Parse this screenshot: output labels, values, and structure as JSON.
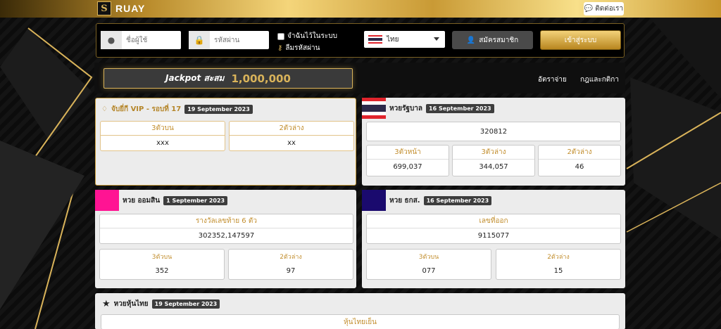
{
  "header": {
    "brand_letter": "S",
    "brand_name": "RUAY",
    "contact_label": "ติดต่อเรา"
  },
  "login": {
    "username_placeholder": "ชื่อผู้ใช้",
    "password_placeholder": "รหัสผ่าน",
    "remember_label": "จำฉันไว้ในระบบ",
    "forgot_label": "ลืมรหัสผ่าน",
    "language": "ไทย",
    "register_label": "สมัครสมาชิก",
    "login_label": "เข้าสู่ระบบ"
  },
  "jackpot": {
    "label": "Jackpot สะสม",
    "value": "1,000,000"
  },
  "nav": {
    "rates": "อัตราจ่าย",
    "rules": "กฎและกติกา"
  },
  "vip": {
    "title": "จับยี่กี VIP - รอบที่ 17",
    "date": "19 September 2023",
    "cols": [
      {
        "label": "3ตัวบน",
        "value": "xxx"
      },
      {
        "label": "2ตัวล่าง",
        "value": "xx"
      }
    ]
  },
  "gov": {
    "title": "หวยรัฐบาล",
    "date": "16 September 2023",
    "first_prize": "320812",
    "cols": [
      {
        "label": "3ตัวหน้า",
        "value": "699,037"
      },
      {
        "label": "3ตัวล่าง",
        "value": "344,057"
      },
      {
        "label": "2ตัวล่าง",
        "value": "46"
      }
    ]
  },
  "gsb": {
    "title": "หวย ออมสิน",
    "date": "1 September 2023",
    "prize_label": "รางวัลเลขท้าย 6 ตัว",
    "prize_value": "302352,147597",
    "cols": [
      {
        "label": "3ตัวบน",
        "value": "352"
      },
      {
        "label": "2ตัวล่าง",
        "value": "97"
      }
    ],
    "color": "#ff1493"
  },
  "baac": {
    "title": "หวย ธกส.",
    "date": "16 September 2023",
    "prize_label": "เลขที่ออก",
    "prize_value": "9115077",
    "cols": [
      {
        "label": "3ตัวบน",
        "value": "077"
      },
      {
        "label": "2ตัวล่าง",
        "value": "15"
      }
    ],
    "color": "#1a0a6e"
  },
  "stock": {
    "title": "หวยหุ้นไทย",
    "date": "19 September 2023",
    "sub_label": "หุ้นไทยเย็น"
  },
  "colors": {
    "gold": "#d9b35a",
    "panel": "#ececec"
  }
}
